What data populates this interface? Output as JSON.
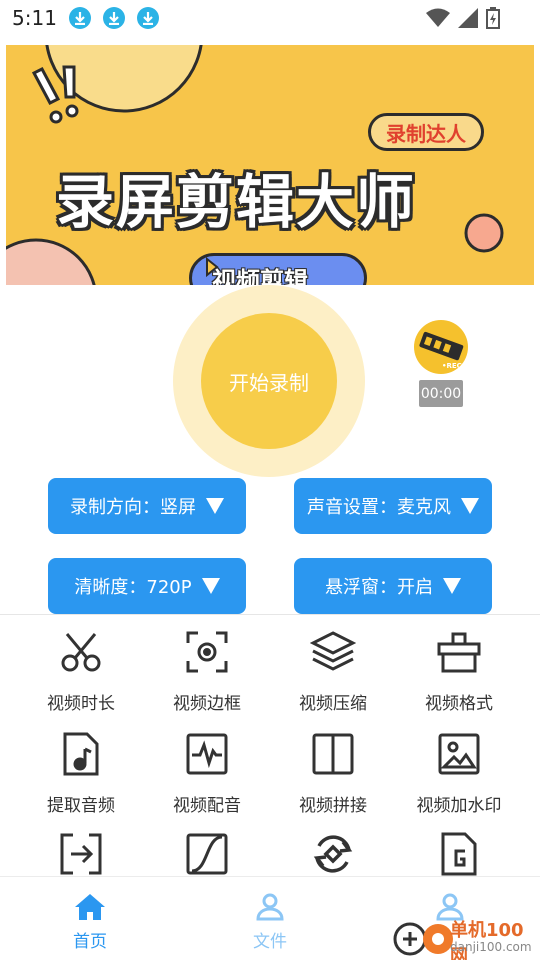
{
  "status_bar": {
    "time": "5:11",
    "icons": [
      "download-icon",
      "download-icon",
      "download-icon",
      "wifi-icon",
      "signal-icon",
      "battery-charging-icon"
    ]
  },
  "banner": {
    "title": "录屏剪辑大师",
    "badge": "录制达人",
    "button_label": "视频剪辑"
  },
  "record": {
    "start_label": "开始录制",
    "timer": "00:00"
  },
  "settings": [
    {
      "label": "录制方向：竖屏"
    },
    {
      "label": "声音设置：麦克风"
    },
    {
      "label": "清晰度：720P"
    },
    {
      "label": "悬浮窗：开启"
    }
  ],
  "tools": [
    {
      "label": "视频时长",
      "icon": "scissors-icon"
    },
    {
      "label": "视频边框",
      "icon": "frame-focus-icon"
    },
    {
      "label": "视频压缩",
      "icon": "layers-icon"
    },
    {
      "label": "视频格式",
      "icon": "gift-box-icon"
    },
    {
      "label": "提取音频",
      "icon": "music-file-icon"
    },
    {
      "label": "视频配音",
      "icon": "waveform-icon"
    },
    {
      "label": "视频拼接",
      "icon": "split-panel-icon"
    },
    {
      "label": "视频加水印",
      "icon": "image-icon"
    },
    {
      "label": "",
      "icon": "import-arrow-icon"
    },
    {
      "label": "",
      "icon": "curve-icon"
    },
    {
      "label": "",
      "icon": "rotate-icon"
    },
    {
      "label": "",
      "icon": "gif-file-icon"
    }
  ],
  "bottom_nav": [
    {
      "label": "首页",
      "icon": "home-icon",
      "active": true
    },
    {
      "label": "文件",
      "icon": "user-icon",
      "active": false
    },
    {
      "label": "",
      "icon": "user-icon",
      "active": false
    }
  ],
  "watermark": {
    "text": "单机100网",
    "url": "danji100.com"
  },
  "colors": {
    "accent": "#2b97f0",
    "record": "#f7cd4a",
    "banner": "#f7c54a",
    "nav_active": "#2b97f0",
    "nav_inactive": "#8cc6f5"
  }
}
